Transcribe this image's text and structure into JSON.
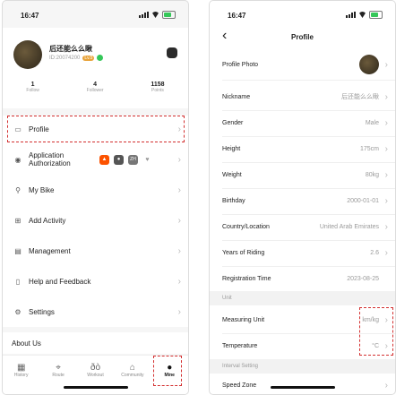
{
  "status": {
    "time": "16:47"
  },
  "account": {
    "username": "后还能么么瞅",
    "user_id": "ID:20074200",
    "level_badge": "Lv.5",
    "stats": [
      {
        "value": "1",
        "label": "Follow"
      },
      {
        "value": "4",
        "label": "Follower"
      },
      {
        "value": "1158",
        "label": "Points"
      }
    ],
    "menu": [
      {
        "label": "Profile",
        "icon": "profile-card-icon"
      },
      {
        "label": "Application Authorization",
        "icon": "shield-icon"
      },
      {
        "label": "My Bike",
        "icon": "bike-icon"
      },
      {
        "label": "Add Activity",
        "icon": "add-activity-icon"
      },
      {
        "label": "Management",
        "icon": "folder-icon"
      },
      {
        "label": "Help and Feedback",
        "icon": "document-icon"
      },
      {
        "label": "Settings",
        "icon": "gear-icon"
      }
    ],
    "auth_apps": [
      {
        "name": "strava",
        "color": "#fc5200",
        "glyph": "▲"
      },
      {
        "name": "app-2",
        "color": "#555555",
        "glyph": "●"
      },
      {
        "name": "app-3",
        "color": "#777777",
        "glyph": "ZH"
      },
      {
        "name": "app-4",
        "color": "#999999",
        "glyph": "♥"
      }
    ],
    "about_label": "About Us",
    "tabs": [
      {
        "label": "History",
        "icon": "history-icon"
      },
      {
        "label": "Route",
        "icon": "route-icon"
      },
      {
        "label": "Workout",
        "icon": "workout-icon"
      },
      {
        "label": "Community",
        "icon": "community-icon"
      },
      {
        "label": "Mine",
        "icon": "person-icon"
      }
    ]
  },
  "profile": {
    "title": "Profile",
    "rows": [
      {
        "label": "Profile Photo",
        "value": ""
      },
      {
        "label": "Nickname",
        "value": "后还能么么瞅"
      },
      {
        "label": "Gender",
        "value": "Male"
      },
      {
        "label": "Height",
        "value": "175cm"
      },
      {
        "label": "Weight",
        "value": "80kg"
      },
      {
        "label": "Birthday",
        "value": "2000-01-01"
      },
      {
        "label": "Country/Location",
        "value": "United Arab Emirates"
      },
      {
        "label": "Years of Riding",
        "value": "2.6"
      },
      {
        "label": "Registration Time",
        "value": "2023-08-25"
      }
    ],
    "unit_section": "Unit",
    "unit_rows": [
      {
        "label": "Measuring Unit",
        "value": "km/kg"
      },
      {
        "label": "Temperature",
        "value": "°C"
      }
    ],
    "interval_section": "Interval Setting",
    "interval_rows": [
      {
        "label": "Speed Zone",
        "value": ""
      }
    ]
  },
  "colors": {
    "highlight": "#d32f2f",
    "accent_green": "#35c759"
  }
}
